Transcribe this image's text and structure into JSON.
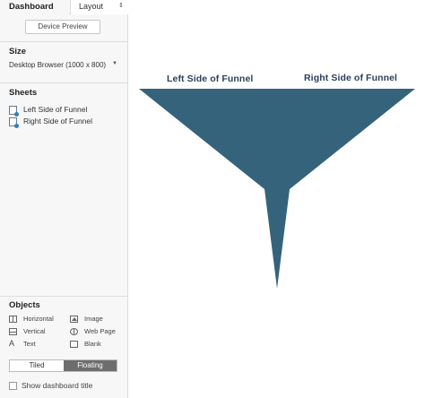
{
  "sidebar": {
    "tabs": {
      "dashboard": "Dashboard",
      "layout": "Layout"
    },
    "device_preview": "Device Preview",
    "size": {
      "title": "Size",
      "value": "Desktop Browser (1000 x 800)"
    },
    "sheets": {
      "title": "Sheets",
      "items": [
        {
          "label": "Left Side of Funnel"
        },
        {
          "label": "Right Side of Funnel"
        }
      ]
    },
    "objects": {
      "title": "Objects",
      "items": [
        {
          "label": "Horizontal",
          "icon": "horizontal-container-icon"
        },
        {
          "label": "Image",
          "icon": "image-icon"
        },
        {
          "label": "Vertical",
          "icon": "vertical-container-icon"
        },
        {
          "label": "Web Page",
          "icon": "web-page-icon"
        },
        {
          "label": "Text",
          "icon": "text-icon"
        },
        {
          "label": "Blank",
          "icon": "blank-icon"
        }
      ]
    },
    "layout_mode": {
      "tiled": "Tiled",
      "floating": "Floating",
      "selected": "Floating"
    },
    "show_title": {
      "label": "Show dashboard title",
      "checked": false
    }
  },
  "canvas": {
    "left_label": "Left Side of Funnel",
    "right_label": "Right Side of Funnel",
    "funnel_color": "#35637b"
  },
  "colors": {
    "sidebar_bg": "#f7f7f7",
    "toggle_selected": "#6d6d6d"
  }
}
